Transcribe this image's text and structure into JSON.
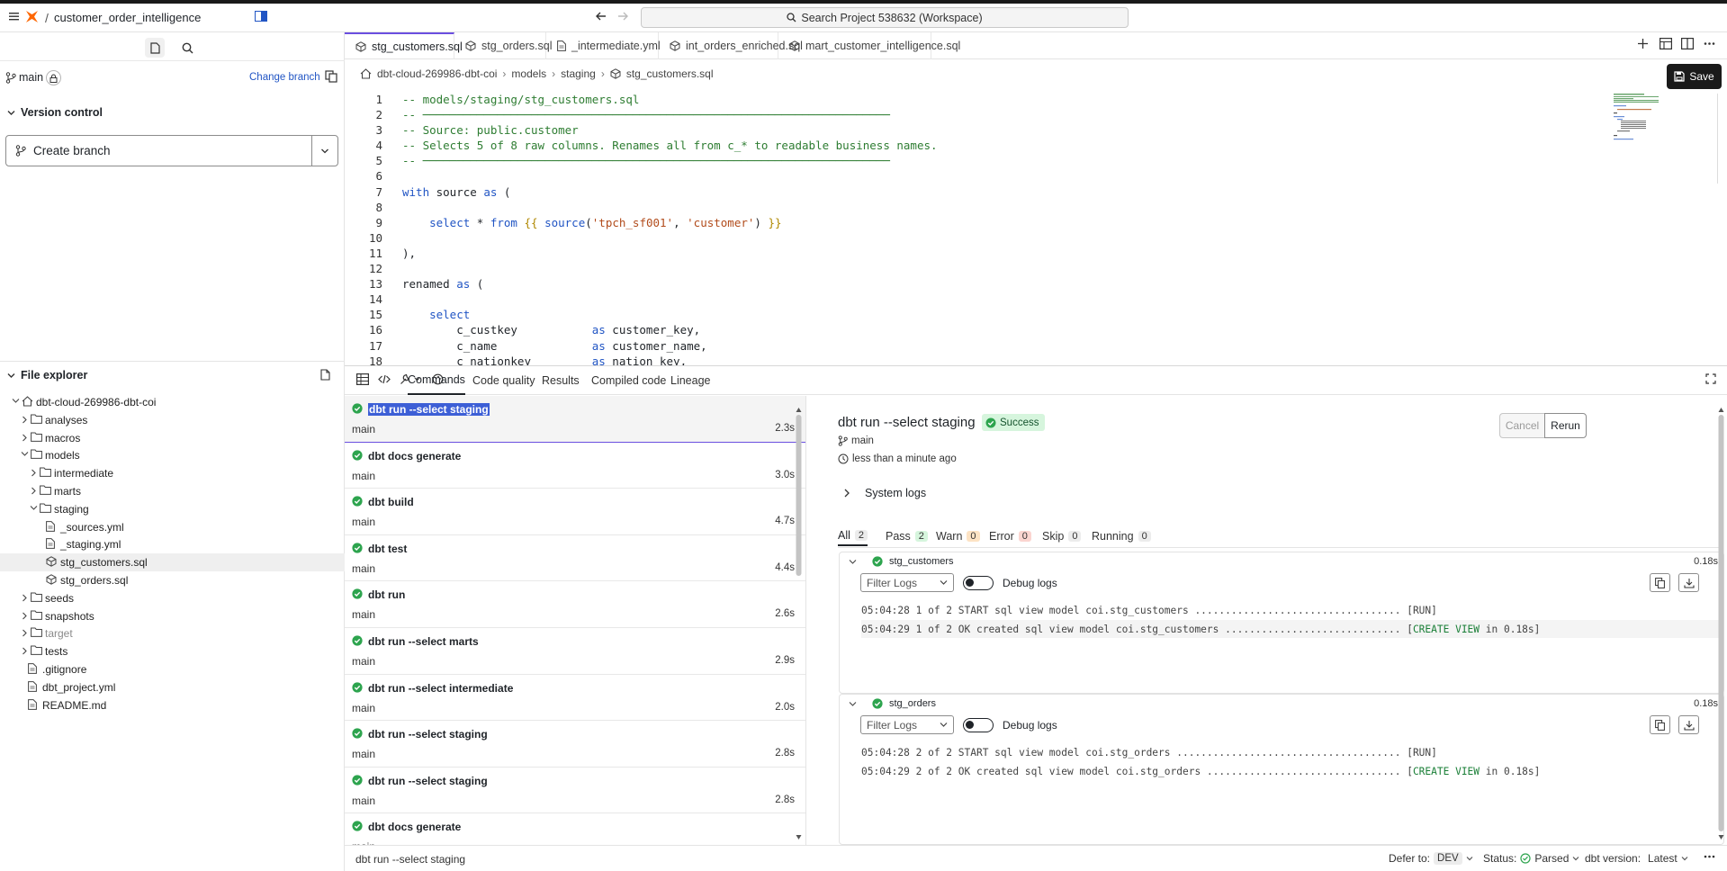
{
  "app": {
    "project_name": "customer_order_intelligence",
    "search_label": "Search Project 538632 (Workspace)"
  },
  "sidebar": {
    "branch": "main",
    "change_branch": "Change branch",
    "version_control": "Version control",
    "create_branch": "Create branch",
    "file_explorer": "File explorer",
    "tree": [
      {
        "label": "dbt-cloud-269986-dbt-coi",
        "type": "root",
        "depth": 0,
        "open": true
      },
      {
        "label": "analyses",
        "type": "folder",
        "depth": 1
      },
      {
        "label": "macros",
        "type": "folder",
        "depth": 1
      },
      {
        "label": "models",
        "type": "folder",
        "depth": 1,
        "open": true
      },
      {
        "label": "intermediate",
        "type": "folder",
        "depth": 2
      },
      {
        "label": "marts",
        "type": "folder",
        "depth": 2
      },
      {
        "label": "staging",
        "type": "folder",
        "depth": 2,
        "open": true
      },
      {
        "label": "_sources.yml",
        "type": "yml",
        "depth": 3
      },
      {
        "label": "_staging.yml",
        "type": "yml",
        "depth": 3
      },
      {
        "label": "stg_customers.sql",
        "type": "model",
        "depth": 3,
        "selected": true
      },
      {
        "label": "stg_orders.sql",
        "type": "model",
        "depth": 3
      },
      {
        "label": "seeds",
        "type": "folder",
        "depth": 1
      },
      {
        "label": "snapshots",
        "type": "folder",
        "depth": 1
      },
      {
        "label": "target",
        "type": "folder",
        "depth": 1,
        "muted": true
      },
      {
        "label": "tests",
        "type": "folder",
        "depth": 1
      },
      {
        "label": ".gitignore",
        "type": "file",
        "depth": 1
      },
      {
        "label": "dbt_project.yml",
        "type": "file",
        "depth": 1
      },
      {
        "label": "README.md",
        "type": "file",
        "depth": 1
      }
    ]
  },
  "tabs": [
    {
      "label": "stg_customers.sql",
      "icon": "model",
      "dot": true,
      "active": true
    },
    {
      "label": "stg_orders.sql",
      "icon": "model",
      "dot": true
    },
    {
      "label": "_intermediate.yml",
      "icon": "yml"
    },
    {
      "label": "int_orders_enriched.sql",
      "icon": "model"
    },
    {
      "label": "mart_customer_intelligence.sql",
      "icon": "model"
    }
  ],
  "breadcrumb": [
    "dbt-cloud-269986-dbt-coi",
    "models",
    "staging",
    "stg_customers.sql"
  ],
  "save_label": "Save",
  "code": [
    "-- models/staging/stg_customers.sql",
    "-- ─────────────────────────────────────────────────────────────────────",
    "-- Source: public.customer",
    "-- Selects 5 of 8 raw columns. Renames all from c_* to readable business names.",
    "-- ─────────────────────────────────────────────────────────────────────",
    "",
    "with source as (",
    "",
    "    select * from {{ source('tpch_sf001', 'customer') }}",
    "",
    "),",
    "",
    "renamed as (",
    "",
    "    select",
    "        c_custkey           as customer_key,",
    "        c_name              as customer_name,",
    "        c_nationkey         as nation_key,"
  ],
  "bottom": {
    "tabs": [
      "Commands",
      "Code quality",
      "Results",
      "Compiled code",
      "Lineage"
    ],
    "commands": [
      {
        "name": "dbt run --select staging",
        "branch": "main",
        "duration": "2.3s",
        "selected": true
      },
      {
        "name": "dbt docs generate",
        "branch": "main",
        "duration": "3.0s"
      },
      {
        "name": "dbt build",
        "branch": "main",
        "duration": "4.7s"
      },
      {
        "name": "dbt test",
        "branch": "main",
        "duration": "4.4s"
      },
      {
        "name": "dbt run",
        "branch": "main",
        "duration": "2.6s"
      },
      {
        "name": "dbt run --select marts",
        "branch": "main",
        "duration": "2.9s"
      },
      {
        "name": "dbt run --select intermediate",
        "branch": "main",
        "duration": "2.0s"
      },
      {
        "name": "dbt run --select staging",
        "branch": "main",
        "duration": "2.8s"
      },
      {
        "name": "dbt run --select staging",
        "branch": "main",
        "duration": "2.8s"
      },
      {
        "name": "dbt docs generate",
        "branch": "main",
        "duration": ""
      }
    ],
    "detail": {
      "title": "dbt run --select staging",
      "status": "Success",
      "branch": "main",
      "time": "less than a minute ago",
      "cancel": "Cancel",
      "rerun": "Rerun",
      "system_logs": "System logs",
      "filters": [
        {
          "label": "All",
          "count": "2",
          "kind": "all"
        },
        {
          "label": "Pass",
          "count": "2",
          "kind": "pass"
        },
        {
          "label": "Warn",
          "count": "0",
          "kind": "warn"
        },
        {
          "label": "Error",
          "count": "0",
          "kind": "err"
        },
        {
          "label": "Skip",
          "count": "0",
          "kind": "skip"
        },
        {
          "label": "Running",
          "count": "0",
          "kind": "run"
        }
      ],
      "filter_logs": "Filter Logs",
      "debug_logs": "Debug logs",
      "models": [
        {
          "name": "stg_customers",
          "duration": "0.18s",
          "logs": [
            {
              "pre": "05:04:28 1 of 2 START sql view model coi.stg_customers .................................. [",
              "hl": "RUN",
              "post": "]",
              "green": false
            },
            {
              "pre": "05:04:29 1 of 2 OK created sql view model coi.stg_customers ............................. [",
              "hl": "CREATE VIEW",
              "post": " in 0.18s]",
              "green": true
            }
          ]
        },
        {
          "name": "stg_orders",
          "duration": "0.18s",
          "logs": [
            {
              "pre": "05:04:28 2 of 2 START sql view model coi.stg_orders ..................................... [",
              "hl": "RUN",
              "post": "]",
              "green": false
            },
            {
              "pre": "05:04:29 2 of 2 OK created sql view model coi.stg_orders ................................ [",
              "hl": "CREATE VIEW",
              "post": " in 0.18s]",
              "green": true
            }
          ]
        }
      ]
    },
    "statusbar": {
      "command": "dbt run --select staging",
      "defer_label": "Defer to:",
      "defer_value": "DEV",
      "status_label": "Status:",
      "status_value": "Parsed",
      "version_label": "dbt version:",
      "version_value": "Latest"
    }
  },
  "colors": {
    "accent": "#6b4fe0",
    "success": "#2da44e",
    "brand": "#fe6703"
  }
}
